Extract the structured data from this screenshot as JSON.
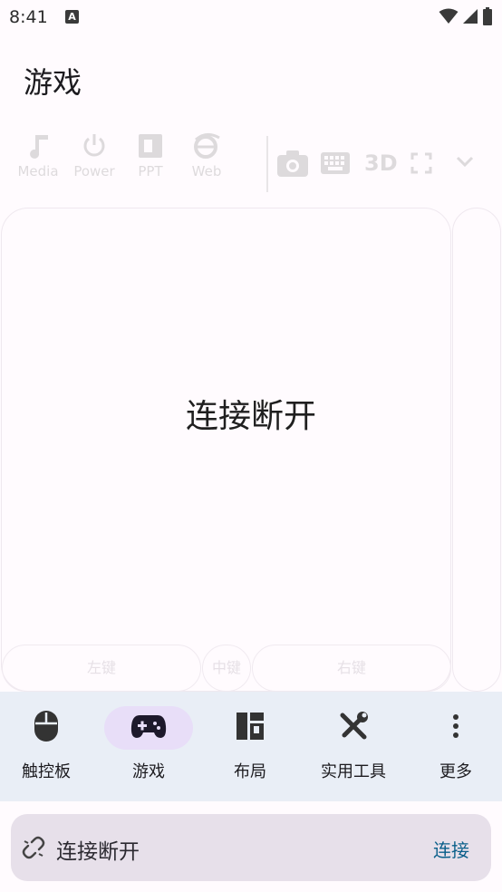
{
  "status_bar": {
    "time": "8:41",
    "notification_icon": "a-letter-app-icon",
    "system_icons": [
      "wifi-icon",
      "signal-icon",
      "battery-icon"
    ]
  },
  "page": {
    "title": "游戏"
  },
  "toolbar": {
    "items": [
      {
        "label": "Media",
        "icon": "music-note-icon"
      },
      {
        "label": "Power",
        "icon": "power-icon"
      },
      {
        "label": "PPT",
        "icon": "powerpoint-icon"
      },
      {
        "label": "Web",
        "icon": "browser-e-icon"
      }
    ],
    "right_items": {
      "camera_icon": "camera-icon",
      "keyboard_icon": "keyboard-icon",
      "threed_label": "3D",
      "fullscreen_icon": "fullscreen-icon",
      "expand_icon": "chevron-down-icon"
    }
  },
  "touchpad": {
    "message": "连接断开",
    "mouse_buttons": {
      "left": "左键",
      "middle": "中键",
      "right": "右键"
    }
  },
  "bottom_nav": {
    "items": [
      {
        "label": "触控板",
        "icon": "mouse-icon",
        "active": false
      },
      {
        "label": "游戏",
        "icon": "gamepad-icon",
        "active": true
      },
      {
        "label": "布局",
        "icon": "layout-icon",
        "active": false
      },
      {
        "label": "实用工具",
        "icon": "tools-icon",
        "active": false
      },
      {
        "label": "更多",
        "icon": "more-vertical-icon",
        "active": false
      }
    ]
  },
  "connection_bar": {
    "icon": "link-broken-icon",
    "status": "连接断开",
    "action_label": "连接"
  },
  "colors": {
    "background": "#fffbfe",
    "nav_background": "#e9eef6",
    "active_pill": "#e8def8",
    "connection_bar": "#e7e0ea",
    "accent": "#0a5f8a"
  }
}
